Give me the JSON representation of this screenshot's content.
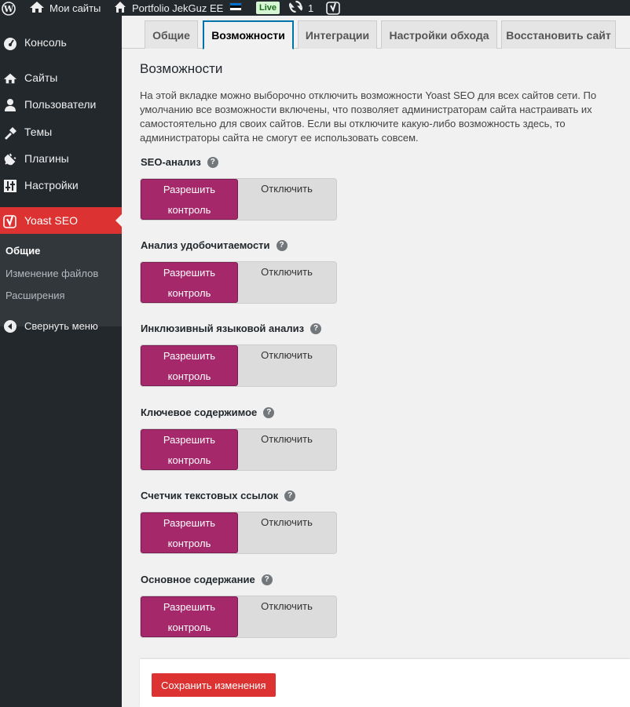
{
  "admin_bar": {
    "my_sites": "Мои сайты",
    "site_name": "Portfolio JekGuz EE",
    "live_badge": "Live",
    "updates_count": "1"
  },
  "sidebar": {
    "items": [
      {
        "label": "Консоль",
        "icon": "dashboard-icon"
      },
      {
        "label": "Сайты",
        "icon": "network-sites-icon"
      },
      {
        "label": "Пользователи",
        "icon": "users-icon"
      },
      {
        "label": "Темы",
        "icon": "themes-icon"
      },
      {
        "label": "Плагины",
        "icon": "plugins-icon"
      },
      {
        "label": "Настройки",
        "icon": "settings-icon"
      },
      {
        "label": "Yoast SEO",
        "icon": "yoast-icon"
      }
    ],
    "submenu": [
      "Общие",
      "Изменение файлов",
      "Расширения"
    ],
    "collapse": "Свернуть меню"
  },
  "tabs": [
    "Общие",
    "Возможности",
    "Интеграции",
    "Настройки обхода",
    "Восстановить сайт"
  ],
  "active_tab": "Возможности",
  "page": {
    "title": "Возможности",
    "intro": "На этой вкладке можно выборочно отключить возможности Yoast SEO для всех сайтов сети. По умолчанию все возможности включены, что позволяет администраторам сайта настраивать их самостоятельно для своих сайтов. Если вы отключите какую-либо возможность здесь, то администраторы сайта не смогут ее использовать совсем."
  },
  "toggle_labels": {
    "on": "Разрешить контроль",
    "off": "Отключить"
  },
  "features": [
    {
      "label": "SEO-анализ",
      "state": "on"
    },
    {
      "label": "Анализ удобочитаемости",
      "state": "on"
    },
    {
      "label": "Инклюзивный языковой анализ",
      "state": "on"
    },
    {
      "label": "Ключевое содержимое",
      "state": "on"
    },
    {
      "label": "Счетчик текстовых ссылок",
      "state": "on"
    },
    {
      "label": "Основное содержание",
      "state": "on"
    }
  ],
  "save_button": "Сохранить изменения",
  "colors": {
    "accent": "#a4286a",
    "save": "#dc3232",
    "active_menu": "#dc3232",
    "tab_border": "#0073aa"
  }
}
